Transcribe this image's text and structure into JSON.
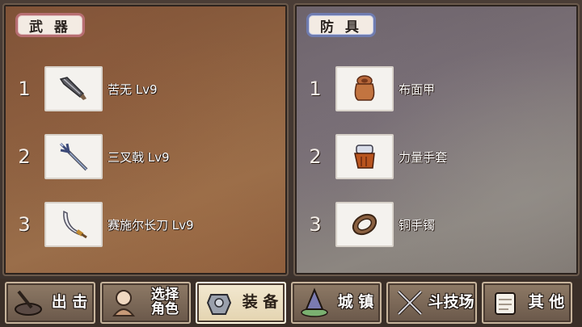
{
  "weapons": {
    "title": "武 器",
    "items": [
      {
        "index": "1",
        "name": "苦无 Lv9",
        "icon": "kunai-icon"
      },
      {
        "index": "2",
        "name": "三叉戟 Lv9",
        "icon": "trident-icon"
      },
      {
        "index": "3",
        "name": "赛施尔长刀 Lv9",
        "icon": "scimitar-icon"
      }
    ]
  },
  "armor": {
    "title": "防 具",
    "items": [
      {
        "index": "1",
        "name": "布面甲",
        "icon": "cloth-armor-icon"
      },
      {
        "index": "2",
        "name": "力量手套",
        "icon": "gauntlet-icon"
      },
      {
        "index": "3",
        "name": "铜手镯",
        "icon": "bracelet-icon"
      }
    ]
  },
  "nav": {
    "sortie": "出 击",
    "select_line1": "选择",
    "select_line2": "角色",
    "equip": "装 备",
    "town": "城 镇",
    "arena": "斗技场",
    "other": "其 他"
  },
  "colors": {
    "weapon_tag_border": "#b76e72",
    "armor_tag_border": "#6f7cb0",
    "active_tab": "#f2e8d0"
  }
}
